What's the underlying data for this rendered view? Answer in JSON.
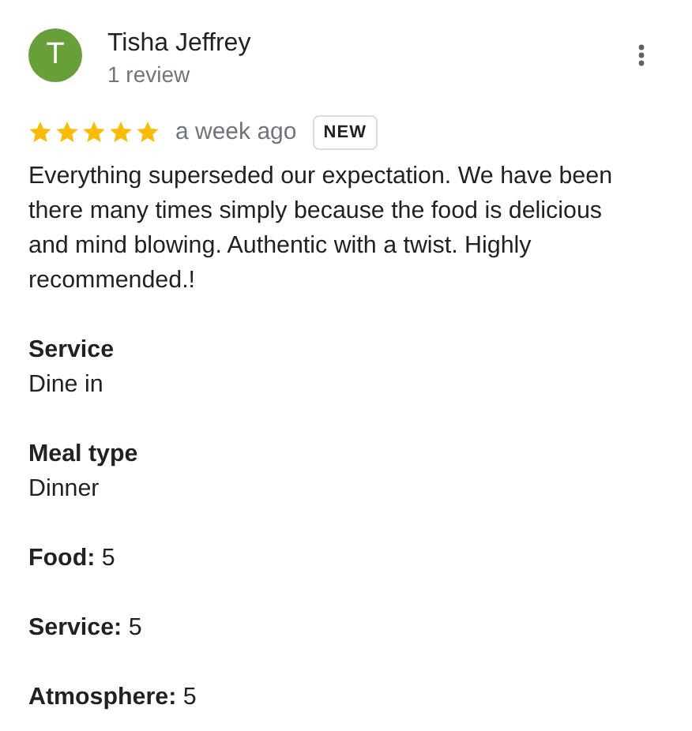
{
  "reviewer": {
    "initial": "T",
    "name": "Tisha Jeffrey",
    "reviews": "1 review"
  },
  "rating": {
    "stars": 5,
    "time": "a week ago",
    "badge": "NEW"
  },
  "text": "Everything superseded our expectation. We have been there many times simply because the food is delicious and mind blowing. Authentic with a twist. Highly recommended.!",
  "details": [
    {
      "label": "Service",
      "value": "Dine in"
    },
    {
      "label": "Meal type",
      "value": "Dinner"
    }
  ],
  "ratings": [
    "**Food:** 5",
    "**Service:** 5",
    "**Atmosphere:** 5"
  ]
}
